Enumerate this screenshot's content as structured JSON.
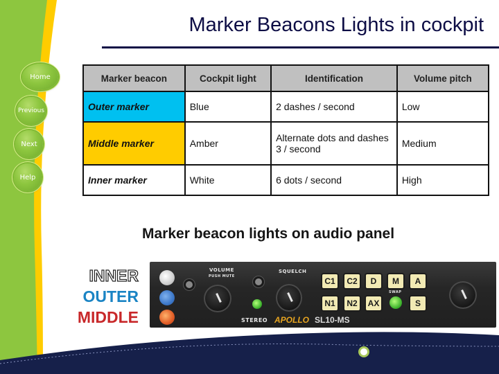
{
  "page": {
    "title": "Marker Beacons Lights in cockpit",
    "subheading": "Marker beacon lights on audio panel"
  },
  "nav": {
    "home": "Home",
    "previous": "Previous",
    "next": "Next",
    "help": "Help"
  },
  "table": {
    "headers": [
      "Marker beacon",
      "Cockpit light",
      "Identification",
      "Volume pitch"
    ],
    "rows": [
      {
        "marker": "Outer marker",
        "light": "Blue",
        "identification": "2 dashes / second",
        "pitch": "Low",
        "color": "#00c0f0"
      },
      {
        "marker": "Middle marker",
        "light": "Amber",
        "identification": "Alternate dots and dashes 3 / second",
        "pitch": "Medium",
        "color": "#ffcc00"
      },
      {
        "marker": "Inner marker",
        "light": "White",
        "identification": "6 dots / second",
        "pitch": "High",
        "color": "#ffffff"
      }
    ]
  },
  "legend": {
    "inner": "INNER",
    "outer": "OUTER",
    "middle": "MIDDLE"
  },
  "audio_panel": {
    "volume_label": "VOLUME",
    "volume_sub": "PUSH MUTE",
    "squelch_label": "SQUELCH",
    "stereo_label": "STEREO",
    "swap_label": "SWAP",
    "buttons_top": [
      "C1",
      "C2",
      "D",
      "M",
      "A"
    ],
    "buttons_bottom": [
      "N1",
      "N2",
      "AX",
      "S"
    ],
    "brand": "APOLLO",
    "model": "SL10-MS"
  },
  "colors": {
    "sidebar_green": "#8dc63f",
    "sidebar_stripe": "#ffcc00",
    "title_navy": "#0d0d45",
    "footer_navy": "#16204a"
  }
}
